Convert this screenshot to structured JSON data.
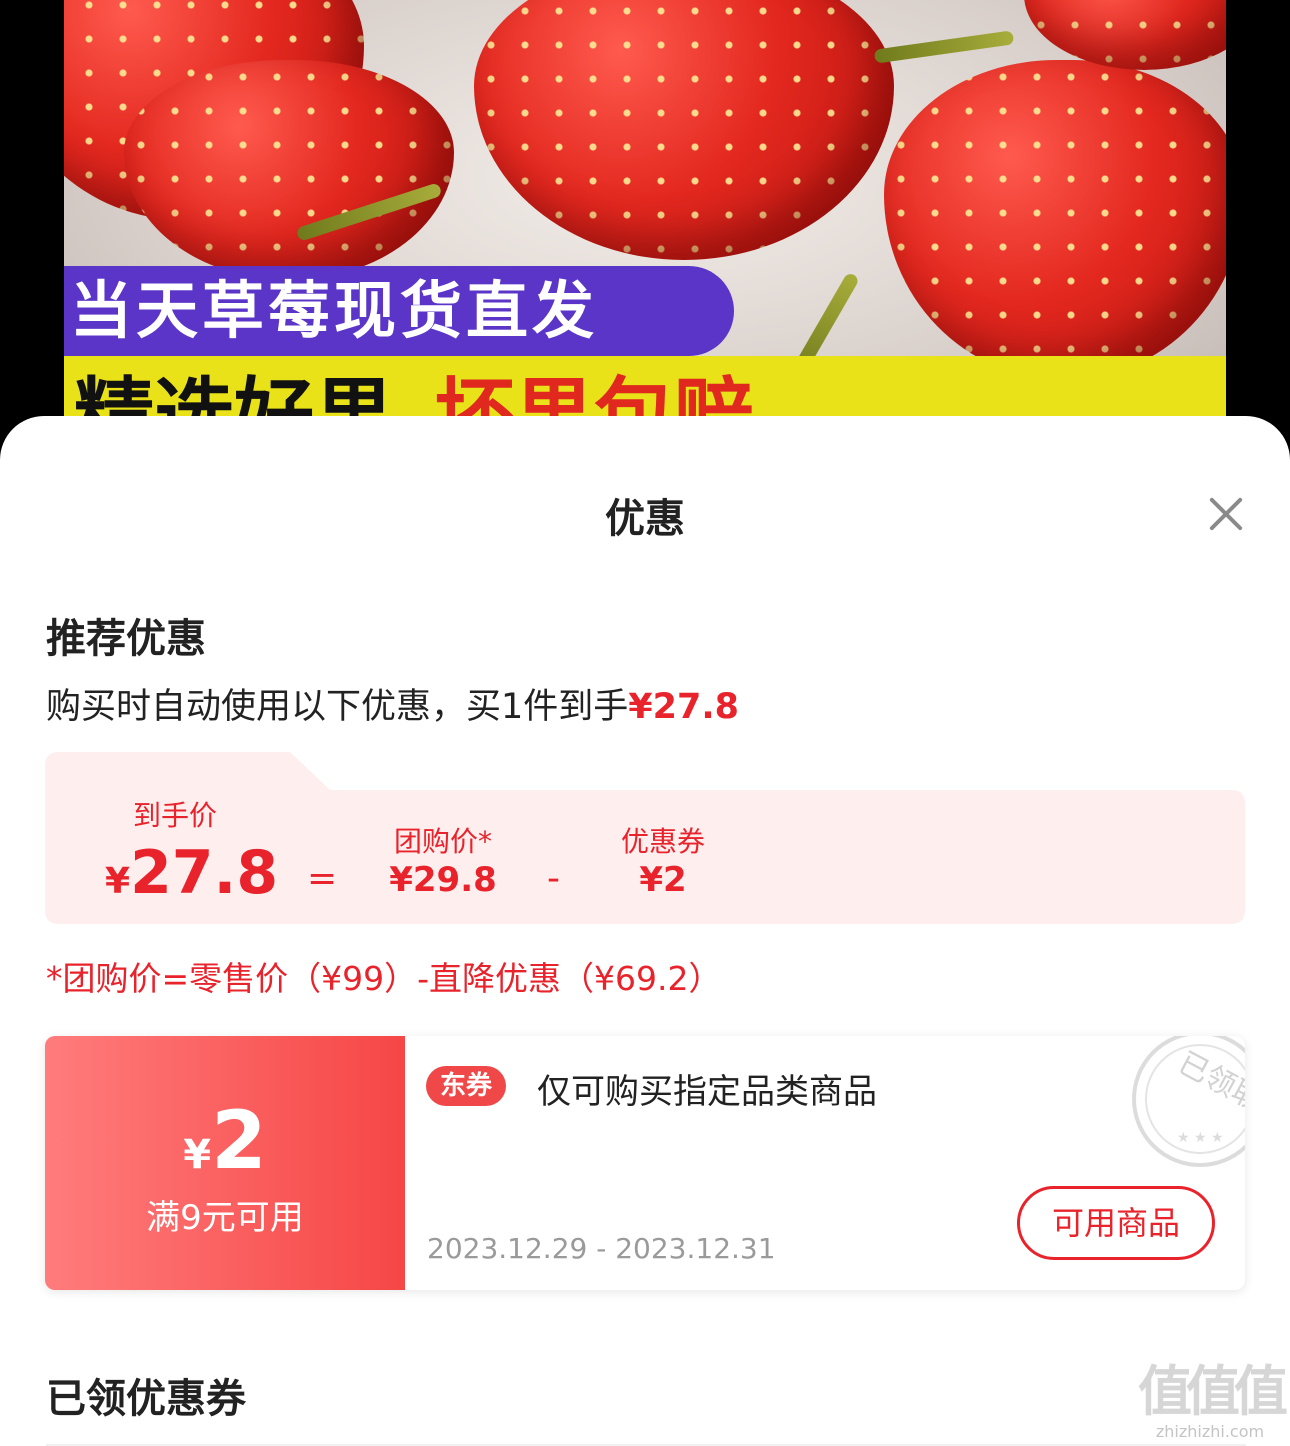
{
  "banner": {
    "tag_text": "当天草莓现货直发",
    "strip_left": "精选好果",
    "strip_right": "坏果包赔"
  },
  "sheet": {
    "title": "优惠"
  },
  "recommend": {
    "title": "推荐优惠",
    "desc_prefix": "购买时自动使用以下优惠，买1件到手",
    "desc_price": "¥27.8"
  },
  "breakdown": {
    "final_label": "到手价",
    "final_currency": "¥",
    "final_value": "27.8",
    "equals": "=",
    "group_label": "团购价*",
    "group_value": "¥29.8",
    "minus": "-",
    "coupon_label": "优惠券",
    "coupon_value": "¥2"
  },
  "note": "*团购价=零售价（¥99）-直降优惠（¥69.2）",
  "coupon": {
    "currency": "¥",
    "amount": "2",
    "condition": "满9元可用",
    "tag": "东券",
    "description": "仅可购买指定品类商品",
    "date_range": "2023.12.29 - 2023.12.31",
    "button_label": "可用商品",
    "stamp_text": "已领取"
  },
  "received": {
    "title": "已领优惠券"
  },
  "watermark": {
    "logo": "值值值",
    "url": "zhizhizhi.com"
  },
  "colors": {
    "accent_red": "#e8232b",
    "card_bg": "#feeeee",
    "coupon_gradient_start": "#ff7c7c",
    "coupon_gradient_end": "#f64646"
  }
}
